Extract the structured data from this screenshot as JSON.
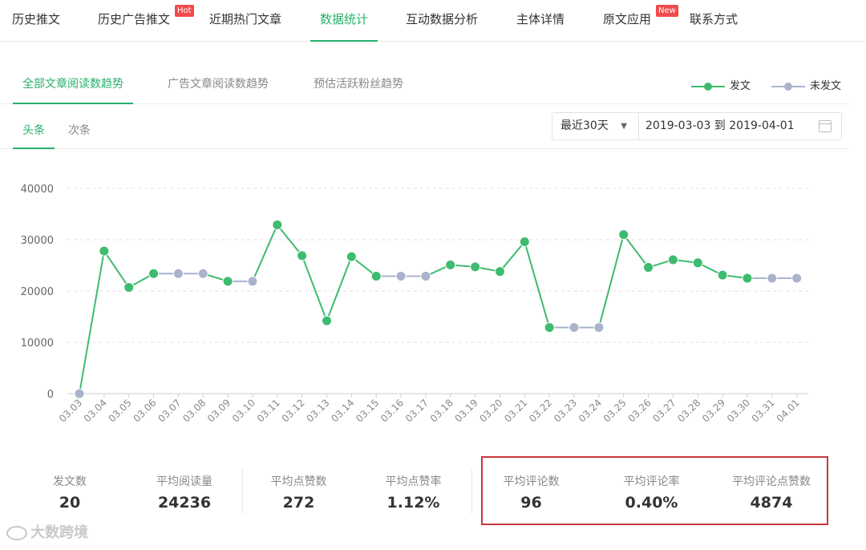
{
  "topnav": {
    "tabs": [
      {
        "label": "历史推文"
      },
      {
        "label": "历史广告推文",
        "badge": "Hot"
      },
      {
        "label": "近期热门文章"
      },
      {
        "label": "数据统计",
        "active": true
      },
      {
        "label": "互动数据分析"
      },
      {
        "label": "主体详情"
      },
      {
        "label": "原文应用",
        "badge": "New"
      },
      {
        "label": "联系方式"
      }
    ]
  },
  "subtabs": [
    {
      "label": "全部文章阅读数趋势",
      "active": true
    },
    {
      "label": "广告文章阅读数趋势"
    },
    {
      "label": "预估活跃粉丝趋势"
    }
  ],
  "legend": {
    "published": "发文",
    "unpublished": "未发文"
  },
  "position_tabs": [
    {
      "label": "头条",
      "active": true
    },
    {
      "label": "次条"
    }
  ],
  "date_filter": {
    "range_select": "最近30天",
    "date_range": "2019-03-03 到 2019-04-01"
  },
  "colors": {
    "accent": "#27b06a",
    "published_line": "#3dbb6e",
    "unpublished_line": "#aab3cb",
    "highlight_box": "#c8383a"
  },
  "chart_data": {
    "type": "line",
    "x": [
      "03.03",
      "03.04",
      "03.05",
      "03.06",
      "03.07",
      "03.08",
      "03.09",
      "03.10",
      "03.11",
      "03.12",
      "03.13",
      "03.14",
      "03.15",
      "03.16",
      "03.17",
      "03.18",
      "03.19",
      "03.20",
      "03.21",
      "03.22",
      "03.23",
      "03.24",
      "03.25",
      "03.26",
      "03.27",
      "03.28",
      "03.29",
      "03.30",
      "03.31",
      "04.01"
    ],
    "values": [
      0,
      27800,
      20700,
      23400,
      23400,
      23400,
      21900,
      21900,
      32900,
      26900,
      14200,
      26700,
      22900,
      22900,
      22900,
      25100,
      24700,
      23800,
      29600,
      12900,
      12900,
      12900,
      31000,
      24600,
      26100,
      25500,
      23100,
      22500,
      22500,
      22500
    ],
    "published": [
      false,
      true,
      true,
      true,
      false,
      false,
      true,
      false,
      true,
      true,
      true,
      true,
      true,
      false,
      false,
      true,
      true,
      true,
      true,
      true,
      false,
      false,
      true,
      true,
      true,
      true,
      true,
      true,
      false,
      false
    ],
    "yticks": [
      0,
      10000,
      20000,
      30000,
      40000
    ],
    "ylim": [
      0,
      40000
    ],
    "grid": true
  },
  "stats": [
    {
      "label": "发文数",
      "value": "20"
    },
    {
      "label": "平均阅读量",
      "value": "24236"
    },
    {
      "label": "平均点赞数",
      "value": "272"
    },
    {
      "label": "平均点赞率",
      "value": "1.12%"
    },
    {
      "label": "平均评论数",
      "value": "96"
    },
    {
      "label": "平均评论率",
      "value": "0.40%"
    },
    {
      "label": "平均评论点赞数",
      "value": "4874"
    }
  ],
  "watermark": "大数跨境"
}
